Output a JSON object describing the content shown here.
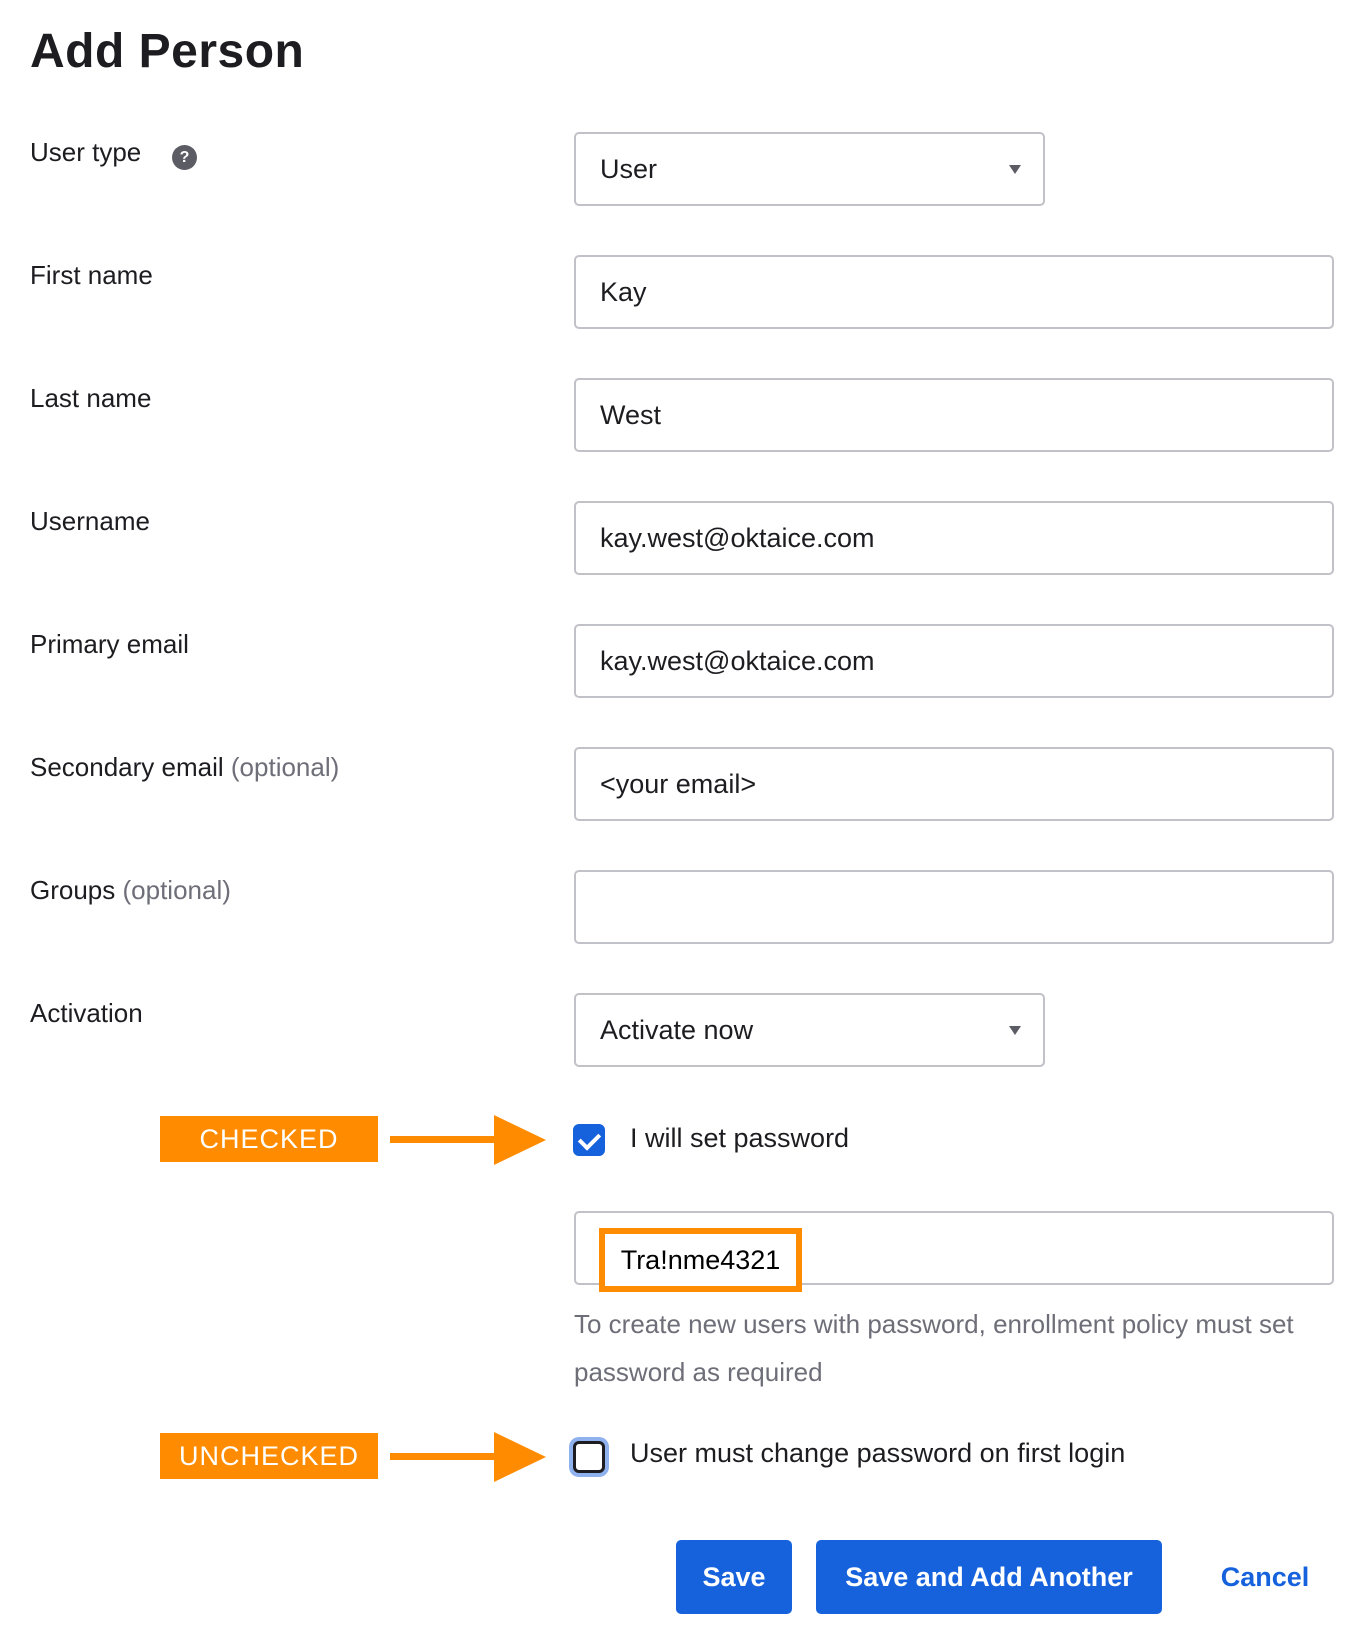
{
  "page": {
    "title": "Add Person"
  },
  "form": {
    "user_type": {
      "label": "User type",
      "help_icon": "?",
      "value": "User"
    },
    "first_name": {
      "label": "First name",
      "value": "Kay"
    },
    "last_name": {
      "label": "Last name",
      "value": "West"
    },
    "username": {
      "label": "Username",
      "value": "kay.west@oktaice.com"
    },
    "primary_email": {
      "label": "Primary email",
      "value": "kay.west@oktaice.com"
    },
    "secondary_email": {
      "label": "Secondary email",
      "optional": "(optional)",
      "value": "<your email>"
    },
    "groups": {
      "label": "Groups",
      "optional": "(optional)",
      "value": ""
    },
    "activation": {
      "label": "Activation",
      "value": "Activate now"
    },
    "set_password": {
      "label": "I will set password",
      "checked": true
    },
    "password": {
      "value": "Tra!nme4321",
      "hint": "To create new users with password, enrollment policy must set password as required"
    },
    "must_change_password": {
      "label": "User must change password on first login",
      "checked": false
    }
  },
  "annotations": {
    "checked_tag": "CHECKED",
    "unchecked_tag": "UNCHECKED",
    "accent_color": "#ff8c00"
  },
  "actions": {
    "save": "Save",
    "save_and_add": "Save and Add Another",
    "cancel": "Cancel"
  },
  "colors": {
    "primary": "#1662dd",
    "annotation": "#ff8c00"
  }
}
